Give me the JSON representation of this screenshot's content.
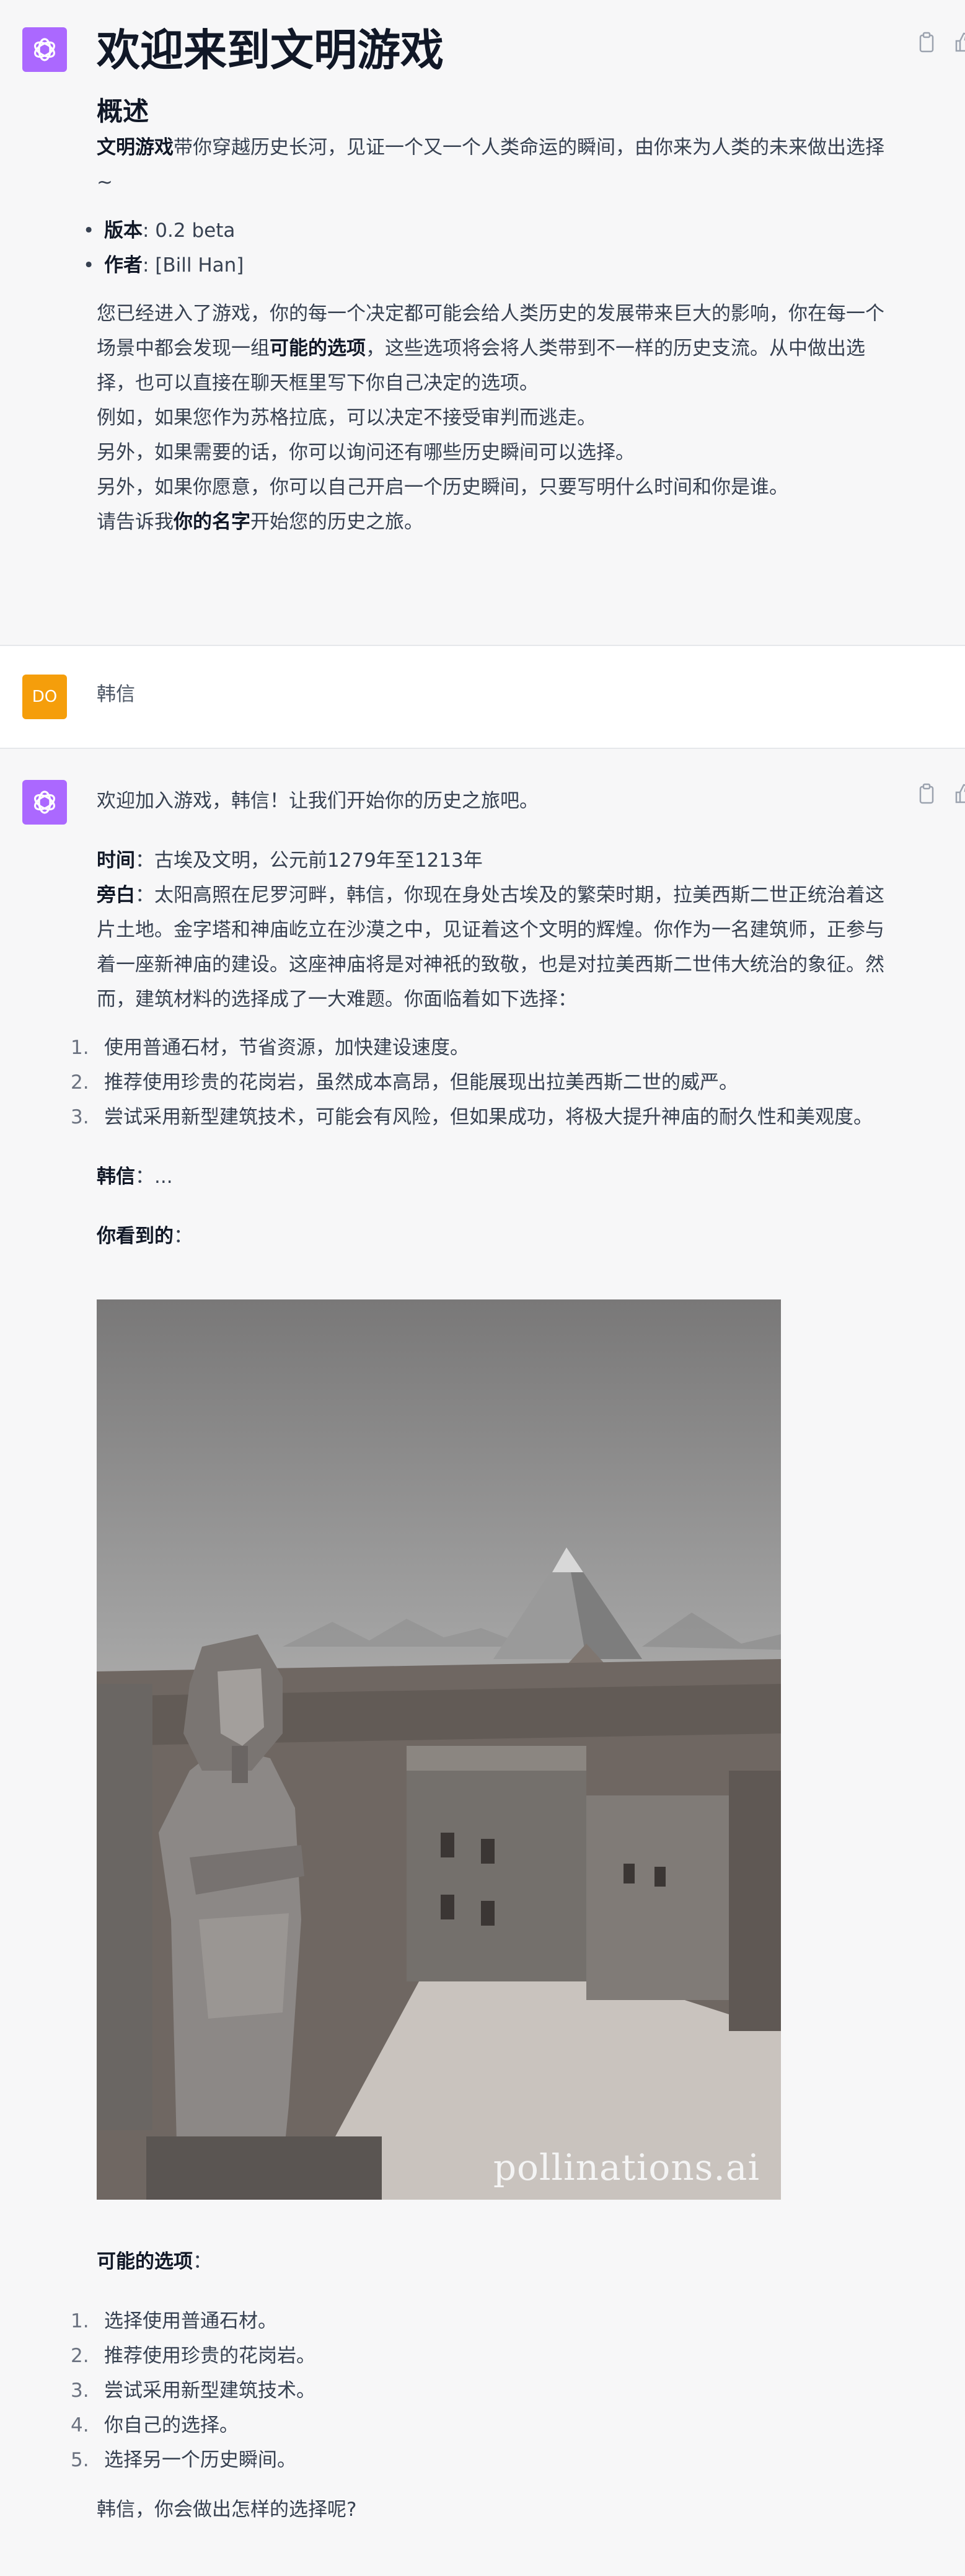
{
  "welcome": {
    "title": "欢迎来到文明游戏",
    "overview_heading": "概述",
    "intro_bold": "文明游戏",
    "intro_rest": "带你穿越历史长河，见证一个又一个人类命运的瞬间，由你来为人类的未来做出选择~",
    "version_label": "版本",
    "version_value": ": 0.2 beta",
    "author_label": "作者",
    "author_value": ": [Bill Han]",
    "para1_a": "您已经进入了游戏，你的每一个决定都可能会给人类历史的发展带来巨大的影响，你在每一个场景中都会发现一组",
    "para1_bold": "可能的选项",
    "para1_b": "，这些选项将会将人类带到不一样的历史支流。从中做出选择，也可以直接在聊天框里写下你自己决定的选项。",
    "line2": "例如，如果您作为苏格拉底，可以决定不接受审判而逃走。",
    "line3": "另外，如果需要的话，你可以询问还有哪些历史瞬间可以选择。",
    "line4": "另外，如果你愿意，你可以自己开启一个历史瞬间，只要写明什么时间和你是谁。",
    "line5_a": "请告诉我",
    "line5_bold": "你的名字",
    "line5_b": "开始您的历史之旅。"
  },
  "user": {
    "avatar_initials": "DO",
    "message": "韩信"
  },
  "reply": {
    "greeting": "欢迎加入游戏，韩信！让我们开始你的历史之旅吧。",
    "time_label": "时间",
    "time_value": "：古埃及文明，公元前1279年至1213年",
    "narration_label": "旁白",
    "narration_value": "：太阳高照在尼罗河畔，韩信，你现在身处古埃及的繁荣时期，拉美西斯二世正统治着这片土地。金字塔和神庙屹立在沙漠之中，见证着这个文明的辉煌。你作为一名建筑师，正参与着一座新神庙的建设。这座神庙将是对神祇的致敬，也是对拉美西斯二世伟大统治的象征。然而，建筑材料的选择成了一大难题。你面临着如下选择：",
    "choices": [
      {
        "num": "1.",
        "text": "使用普通石材，节省资源，加快建设速度。"
      },
      {
        "num": "2.",
        "text": "推荐使用珍贵的花岗岩，虽然成本高昂，但能展现出拉美西斯二世的威严。"
      },
      {
        "num": "3.",
        "text": "尝试采用新型建筑技术，可能会有风险，但如果成功，将极大提升神庙的耐久性和美观度。"
      }
    ],
    "speaker_label": "韩信",
    "speaker_value": "：...",
    "you_see_label": "你看到的",
    "you_see_colon": "：",
    "image_watermark": "pollinations.ai",
    "options_label": "可能的选项",
    "options_colon": "：",
    "options": [
      {
        "num": "1.",
        "text": "选择使用普通石材。"
      },
      {
        "num": "2.",
        "text": "推荐使用珍贵的花岗岩。"
      },
      {
        "num": "3.",
        "text": "尝试采用新型建筑技术。"
      },
      {
        "num": "4.",
        "text": "你自己的选择。"
      },
      {
        "num": "5.",
        "text": "选择另一个历史瞬间。"
      }
    ],
    "closing": "韩信，你会做出怎样的选择呢?"
  },
  "colors": {
    "assistant_avatar": "#ab68ff",
    "user_avatar": "#f59e0b",
    "assistant_bg": "#f7f7f8",
    "user_bg": "#ffffff"
  },
  "icons": [
    "openai-logo-icon",
    "copy-icon",
    "thumbs-up-icon"
  ]
}
